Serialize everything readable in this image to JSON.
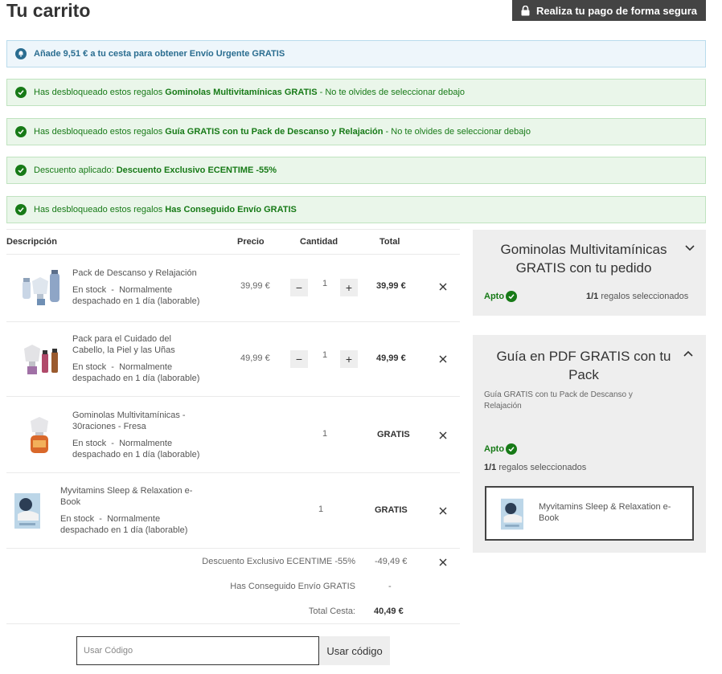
{
  "header": {
    "title": "Tu carrito",
    "secure_label": "Realiza tu pago de forma segura"
  },
  "alerts": {
    "info": "Añade 9,51 € a tu cesta para obtener Envío Urgente GRATIS",
    "gift1": {
      "pre": "Has desbloqueado estos regalos ",
      "bold": "Gominolas Multivitamínicas GRATIS",
      "post": " - No te olvides de seleccionar debajo"
    },
    "gift2": {
      "pre": "Has desbloqueado estos regalos ",
      "bold": "Guía GRATIS con tu Pack de Descanso y Relajación",
      "post": " - No te olvides de seleccionar debajo"
    },
    "discount": {
      "pre": "Descuento aplicado: ",
      "bold": "Descuento Exclusivo ECENTIME -55%"
    },
    "shipping": {
      "pre": "Has desbloqueado estos regalos ",
      "bold": "Has Conseguido Envío GRATIS"
    }
  },
  "table": {
    "headers": {
      "description": "Descripción",
      "price": "Precio",
      "quantity": "Cantidad",
      "total": "Total"
    },
    "minus": "−",
    "plus": "+",
    "rows": [
      {
        "name_line1": "Pack de Descanso y Relajación",
        "name_line2": "",
        "stock_line1": "En stock  -  Normalmente",
        "stock_line2": "despachado en 1 día (laborable)",
        "price": "39,99 €",
        "qty": "1",
        "total": "39,99 €"
      },
      {
        "name_line1": "Pack para el Cuidado del",
        "name_line2": "Cabello, la Piel y las Uñas",
        "stock_line1": "En stock  -  Normalmente",
        "stock_line2": "despachado en 1 día (laborable)",
        "price": "49,99 €",
        "qty": "1",
        "total": "49,99 €"
      },
      {
        "name_line1": "Gominolas Multivitamínicas -",
        "name_line2": "30raciones - Fresa",
        "stock_line1": "En stock  -  Normalmente",
        "stock_line2": "despachado en 1 día (laborable)",
        "price": "",
        "qty": "1",
        "total": "GRATIS"
      },
      {
        "name_line1": "Myvitamins Sleep & Relaxation e-",
        "name_line2": "Book",
        "stock_line1": "En stock  -  Normalmente",
        "stock_line2": "despachado en 1 día (laborable)",
        "price": "",
        "qty": "1",
        "total": "GRATIS"
      }
    ]
  },
  "summary": {
    "discount_label": "Descuento Exclusivo ECENTIME -55%",
    "discount_value": "-49,49 €",
    "shipping_label": "Has Conseguido Envío GRATIS",
    "shipping_value": "-",
    "total_label": "Total Cesta:",
    "total_value": "40,49 €"
  },
  "coupon": {
    "placeholder": "Usar Código",
    "button": "Usar código"
  },
  "panels": {
    "gummies": {
      "title_line1": "Gominolas Multivitamínicas",
      "title_line2": "GRATIS con tu pedido",
      "apto": "Apto",
      "count": "1/1",
      "count_label": " regalos seleccionados"
    },
    "guide": {
      "title_line1": "Guía en PDF GRATIS con tu",
      "title_line2": "Pack",
      "desc_line1": "Guía GRATIS con tu Pack de Descanso y",
      "desc_line2": "Relajación",
      "apto": "Apto",
      "count": "1/1",
      "count_label": " regalos seleccionados",
      "gift_line1": "Myvitamins Sleep & Relaxation e-",
      "gift_line2": "Book"
    }
  },
  "colors": {
    "success": "#177a17",
    "info": "#2a6d90",
    "dark_button": "#444444",
    "panel_bg": "#eeeeee"
  }
}
